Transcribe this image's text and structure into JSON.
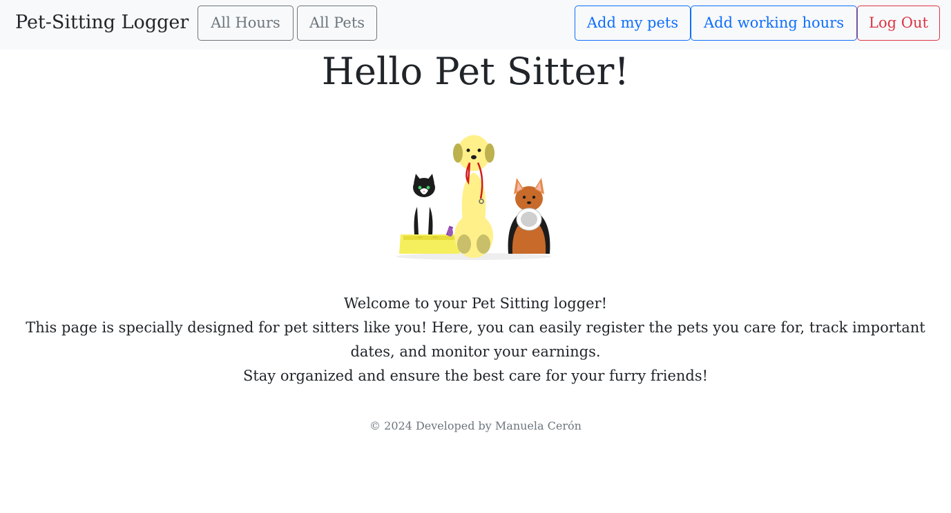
{
  "navbar": {
    "brand": "Pet-Sitting Logger",
    "left_buttons": {
      "all_hours": "All Hours",
      "all_pets": "All Pets"
    },
    "right_buttons": {
      "add_pets": "Add my pets",
      "add_hours": "Add working hours",
      "logout": "Log Out"
    }
  },
  "main": {
    "title": "Hello Pet Sitter!",
    "illustration_icon": "pets-illustration",
    "welcome_line1": "Welcome to your Pet Sitting logger!",
    "welcome_line2": "This page is specially designed for pet sitters like you! Here, you can easily register the pets you care for, track important dates, and monitor your earnings.",
    "welcome_line3": "Stay organized and ensure the best care for your furry friends!"
  },
  "footer": {
    "text": "© 2024 Developed by Manuela Cerón"
  },
  "colors": {
    "navbar_bg": "#f8f9fa",
    "secondary": "#6c757d",
    "primary": "#0d6efd",
    "danger": "#dc3545"
  }
}
